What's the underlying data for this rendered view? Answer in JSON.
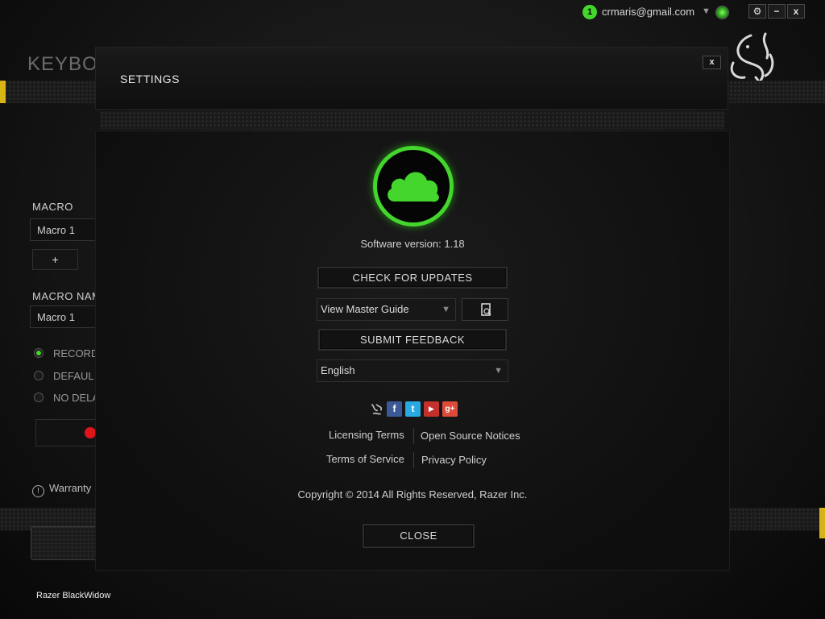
{
  "topbar": {
    "notification_count": "1",
    "user_email": "crmaris@gmail.com",
    "caret": "▼",
    "settings_btn": "⚙",
    "minimize_btn": "−",
    "close_btn": "x"
  },
  "background": {
    "page_title": "KEYBOA",
    "macro_label": "MACRO",
    "macro_select_value": "Macro 1",
    "add_button": "+",
    "macro_name_label": "MACRO NAM",
    "macro_name_value": "Macro 1",
    "radio_options": [
      "RECORD",
      "DEFAUL",
      "NO DELA"
    ],
    "warranty": "Warranty",
    "device_name": "Razer BlackWidow"
  },
  "settings": {
    "title": "SETTINGS",
    "close_x": "x",
    "software_version": "Software version: 1.18",
    "check_updates": "CHECK FOR UPDATES",
    "guide_select": "View Master Guide",
    "submit_feedback": "SUBMIT FEEDBACK",
    "language": "English",
    "social": [
      "razer-icon",
      "facebook-icon",
      "twitter-icon",
      "youtube-icon",
      "google-plus-icon"
    ],
    "links": {
      "licensing": "Licensing Terms",
      "open_source": "Open Source Notices",
      "tos": "Terms of Service",
      "privacy": "Privacy Policy"
    },
    "copyright": "Copyright © 2014 All Rights Reserved, Razer Inc.",
    "close_button": "CLOSE"
  },
  "colors": {
    "accent_green": "#44d62c",
    "tab_yellow": "#d8b316",
    "record_red": "#e0141c"
  }
}
